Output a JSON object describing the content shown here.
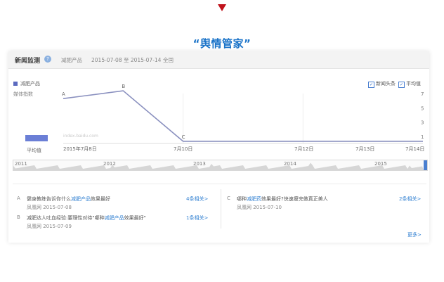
{
  "headline": "“舆情管家”",
  "toolbar": {
    "title": "新闻监测",
    "help_icon": "?",
    "keyword": "减肥产品",
    "range": "2015-07-08 至 2015-07-14",
    "scope": "全国"
  },
  "chart": {
    "legend_series": "减肥产品",
    "y_label": "媒体指数",
    "checkbox_headline": "新闻头条",
    "checkbox_average": "平均值",
    "y_ticks": [
      "7",
      "5",
      "3",
      "1"
    ],
    "x_labels": [
      "2015年7月8日",
      "7月10日",
      "7月12日",
      "7月13日",
      "7月14日"
    ],
    "avg_label": "平均值",
    "watermark": "index.baidu.com",
    "point_labels": [
      "A",
      "B",
      "C"
    ],
    "navigator_years": [
      "2011",
      "2012",
      "2013",
      "2014",
      "2015"
    ]
  },
  "chart_data": {
    "type": "line",
    "x": [
      "2015-07-08",
      "2015-07-09",
      "2015-07-10",
      "2015-07-11",
      "2015-07-12",
      "2015-07-13",
      "2015-07-14"
    ],
    "series": [
      {
        "name": "减肥产品",
        "values": [
          6.3,
          7.4,
          0.3,
          0.3,
          0.3,
          0.3,
          0.3
        ]
      }
    ],
    "ylim": [
      0,
      8
    ],
    "annotations": [
      "A",
      "B",
      "C"
    ]
  },
  "news": [
    {
      "letter": "A",
      "title_pre": "健身教练告诉你什么",
      "title_kw": "减肥产品",
      "title_post": "效果最好",
      "source": "凤凰网 2015-07-08",
      "related": "4条相关>"
    },
    {
      "letter": "B",
      "title_pre": "减肥达人吐血经验:要理性对待\"哪种",
      "title_kw": "减肥产品",
      "title_post": "效果最好\"",
      "source": "凤凰网 2015-07-09",
      "related": "1条相关>"
    },
    {
      "letter": "C",
      "title_pre": "哪种",
      "title_kw": "减肥药",
      "title_post": "效果最好?快速瘦完做真正美人",
      "source": "凤凰网 2015-07-10",
      "related": "2条相关>"
    }
  ],
  "more_label": "更多>",
  "colors": {
    "accent": "#1a73c8",
    "series": "#8a90bf",
    "avg_bar": "#6b7fd6",
    "arrow": "#c0121b"
  }
}
